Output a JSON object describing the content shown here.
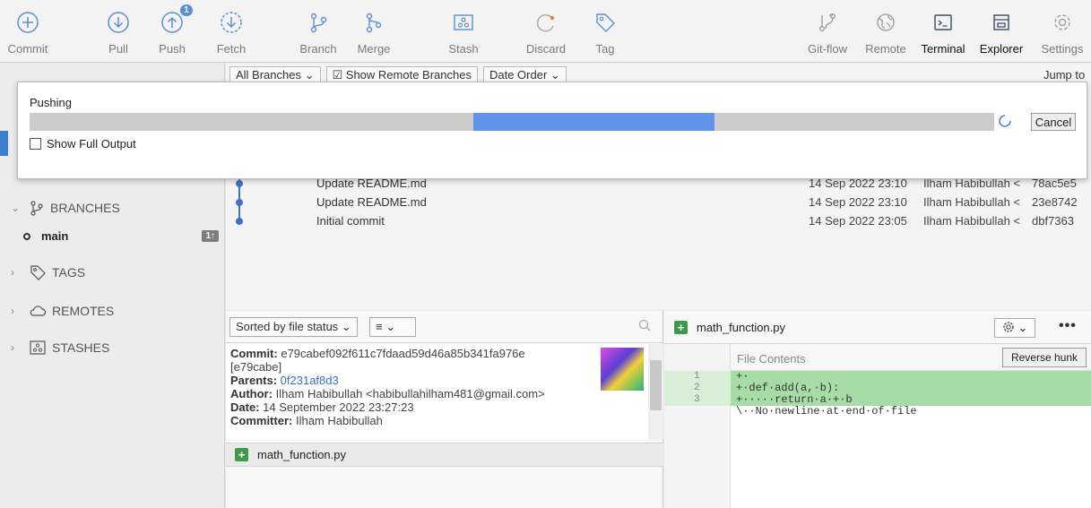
{
  "toolbar": {
    "commit": "Commit",
    "pull": "Pull",
    "push": "Push",
    "push_badge": "1",
    "fetch": "Fetch",
    "branch": "Branch",
    "merge": "Merge",
    "stash": "Stash",
    "discard": "Discard",
    "tag": "Tag",
    "gitflow": "Git-flow",
    "remote": "Remote",
    "terminal": "Terminal",
    "explorer": "Explorer",
    "settings": "Settings"
  },
  "history": {
    "filter_branches": "All Branches",
    "show_remote": "Show Remote Branches",
    "order": "Date Order",
    "jump_to": "Jump to",
    "commits": [
      {
        "message": "Update README.md",
        "date": "14 Sep 2022 23:10",
        "author": "Ilham Habibullah <",
        "hash": "78ac5e5"
      },
      {
        "message": "Update README.md",
        "date": "14 Sep 2022 23:10",
        "author": "Ilham Habibullah <",
        "hash": "23e8742"
      },
      {
        "message": "Initial commit",
        "date": "14 Sep 2022 23:05",
        "author": "Ilham Habibullah <",
        "hash": "dbf7363"
      }
    ]
  },
  "sidebar": {
    "branches": "BRANCHES",
    "branch_main": "main",
    "branch_ahead": "1↑",
    "tags": "TAGS",
    "remotes": "REMOTES",
    "stashes": "STASHES"
  },
  "dialog": {
    "title": "Pushing",
    "progress_start": 0.46,
    "progress_end": 0.71,
    "cancel": "Cancel",
    "show_full_output": "Show Full Output"
  },
  "files": {
    "sort_label": "Sorted by file status",
    "commit_label": "Commit:",
    "commit_hash": "e79cabef092f611c7fdaad59d46a85b341fa976e",
    "short_hash": "[e79cabe]",
    "parents_label": "Parents:",
    "parents": "0f231af8d3",
    "author_label": "Author:",
    "author": "Ilham Habibullah <habibullahilham481@gmail.com>",
    "date_label": "Date:",
    "date": "14 September 2022 23:27:23",
    "committer_label": "Committer:",
    "committer": "Ilham Habibullah",
    "file_name": "math_function.py"
  },
  "diff": {
    "file_name": "math_function.py",
    "hunk_title": "File Contents",
    "reverse_hunk": "Reverse hunk",
    "line_numbers": [
      "1",
      "2",
      "3"
    ],
    "lines": [
      "+·",
      "+·def·add(a,·b):",
      "+·····return·a·+·b",
      "\\··No·newline·at·end·of·file"
    ]
  }
}
